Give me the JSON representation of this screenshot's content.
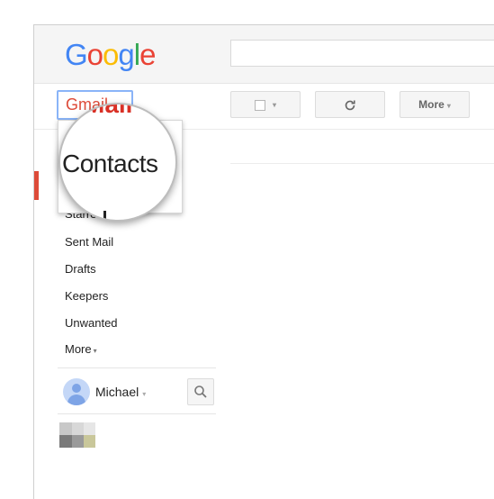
{
  "header": {
    "logo_letters": [
      "G",
      "o",
      "o",
      "g",
      "l",
      "e"
    ],
    "search_value": ""
  },
  "toolbar": {
    "app_switcher_label": "Gmail",
    "app_switcher_caret": "▾",
    "select_caret": "▾",
    "refresh_icon": "refresh-icon",
    "more_label": "More",
    "more_caret": "▾"
  },
  "dropdown": {
    "partial_top_label": "Mail",
    "highlighted_label": "Contacts"
  },
  "sidebar": {
    "items": [
      {
        "label": "Starred"
      },
      {
        "label": "Sent Mail"
      },
      {
        "label": "Drafts"
      },
      {
        "label": "Keepers"
      },
      {
        "label": "Unwanted"
      }
    ],
    "more_label": "More",
    "more_caret": "▾"
  },
  "hangouts": {
    "user_name": "Michael",
    "user_caret": "▾",
    "search_icon": "search-icon"
  },
  "colors": {
    "gmail_red": "#dd4b39",
    "focus_blue": "#8ab4f8",
    "avatar_blue": "#7ea4e6"
  }
}
